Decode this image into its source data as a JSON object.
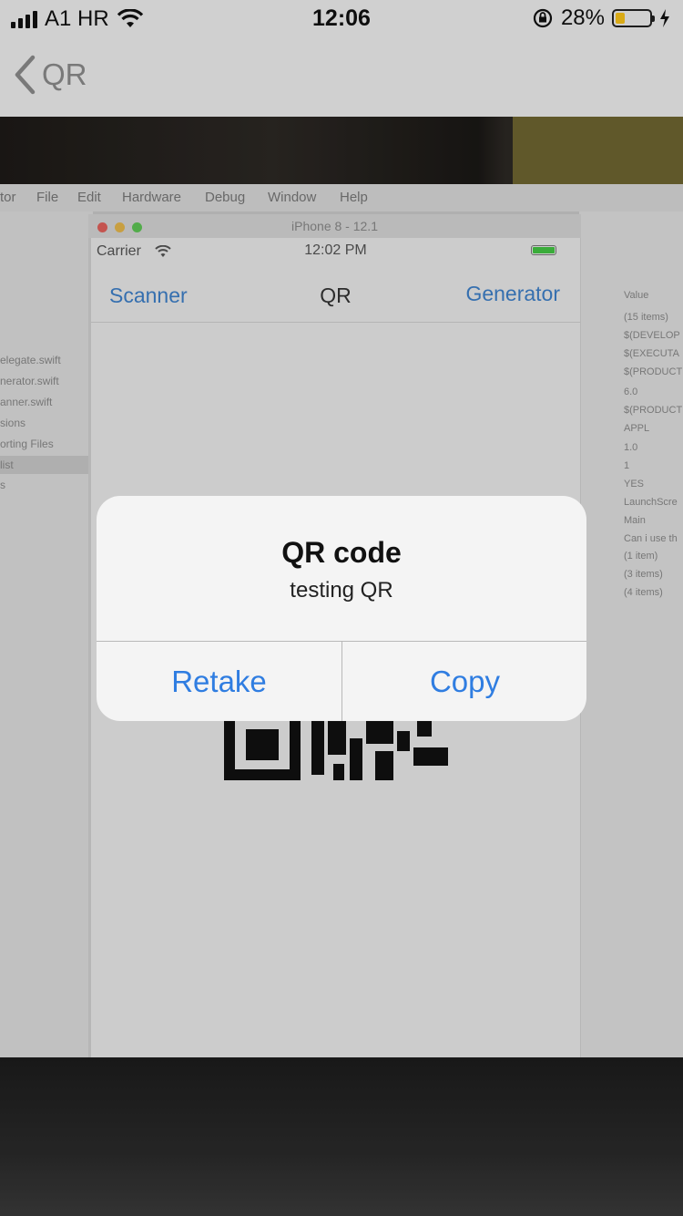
{
  "status_bar": {
    "carrier": "A1 HR",
    "time": "12:06",
    "battery_percent": "28%",
    "battery_level": 0.28,
    "battery_color": "#f7c21a"
  },
  "nav": {
    "back_label": "QR"
  },
  "background_photo": {
    "mac_menu": [
      "tor",
      "File",
      "Edit",
      "Hardware",
      "Debug",
      "Window",
      "Help"
    ],
    "sidebar_files": [
      "elegate.swift",
      "nerator.swift",
      "anner.swift",
      "sions",
      "orting Files",
      "list",
      "s"
    ],
    "inspector_values": [
      "Value",
      "(15 items)",
      "$(DEVELOP",
      "$(EXECUTA",
      "$(PRODUCT",
      "6.0",
      "$(PRODUCT",
      "APPL",
      "1.0",
      "1",
      "YES",
      "LaunchScre",
      "Main",
      "Can i use th",
      "(1 item)",
      "(3 items)",
      "(4 items)"
    ],
    "simulator": {
      "window_title": "iPhone 8 - 12.1",
      "carrier": "Carrier",
      "time": "12:02 PM",
      "left_button": "Scanner",
      "title": "QR",
      "right_button": "Generator"
    }
  },
  "alert": {
    "title": "QR code",
    "message": "testing QR",
    "buttons": [
      "Retake",
      "Copy"
    ],
    "button_color": "#2f7de1"
  }
}
